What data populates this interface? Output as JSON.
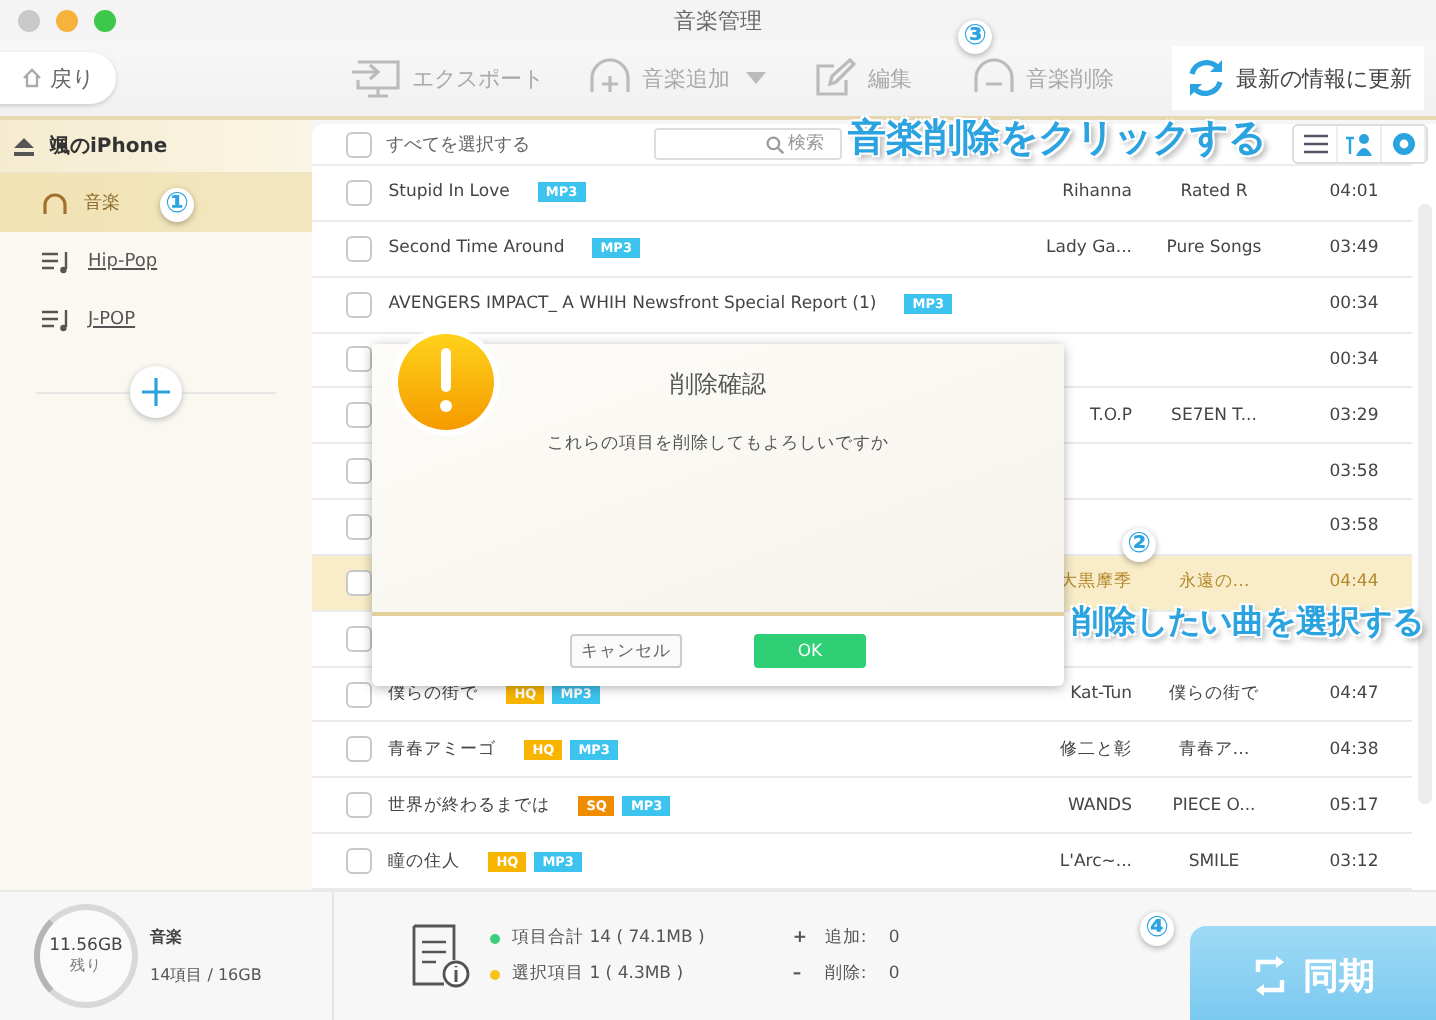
{
  "window": {
    "title": "音楽管理"
  },
  "toolbar": {
    "back": "戻り",
    "items": [
      {
        "kind": "export",
        "label": "エクスポート"
      },
      {
        "kind": "add",
        "label": "音楽追加"
      },
      {
        "kind": "edit",
        "label": "編集"
      },
      {
        "kind": "delete",
        "label": "音楽削除"
      }
    ],
    "refresh": "最新の情報に更新"
  },
  "sidebar": {
    "device": "颯のiPhone",
    "items": [
      {
        "kind": "music",
        "label": "音楽",
        "selected": true
      },
      {
        "kind": "playlist",
        "label": "Hip-Pop",
        "selected": false
      },
      {
        "kind": "playlist",
        "label": "J-POP",
        "selected": false
      }
    ]
  },
  "list_header": {
    "select_all": "すべてを選択する",
    "checked": false,
    "search": {
      "placeholder": "検索"
    }
  },
  "rows": [
    {
      "title": "Stupid In Love",
      "tags": [
        {
          "label": "MP3",
          "color": "#3cc3ee"
        }
      ],
      "artist": "Rihanna",
      "album": "Rated R",
      "time": "04:01",
      "selected": false
    },
    {
      "title": "Second Time Around",
      "tags": [
        {
          "label": "MP3",
          "color": "#3cc3ee"
        }
      ],
      "artist": "Lady Ga...",
      "album": "Pure Songs",
      "time": "03:49",
      "selected": false
    },
    {
      "title": "AVENGERS IMPACT_ A WHIH Newsfront Special Report (1)",
      "tags": [
        {
          "label": "MP3",
          "color": "#3cc3ee"
        }
      ],
      "time": "00:34",
      "selected": false
    },
    {
      "time": "00:34",
      "selected": false
    },
    {
      "artist": "T.O.P",
      "album": "SE7EN T...",
      "time": "03:29",
      "selected": false
    },
    {
      "time": "03:58",
      "selected": false
    },
    {
      "time": "03:58",
      "selected": false
    },
    {
      "artist": "大黒摩季",
      "album": "永遠の…",
      "time": "04:44",
      "selected": true
    },
    {
      "selected": false
    },
    {
      "title": "僕らの街で",
      "tags": [
        {
          "label": "HQ",
          "color": "#f7b500"
        },
        {
          "label": "MP3",
          "color": "#3cc3ee"
        }
      ],
      "artist": "Kat-Tun",
      "album": "僕らの街で",
      "time": "04:47",
      "selected": false
    },
    {
      "title": "青春アミーゴ",
      "tags": [
        {
          "label": "HQ",
          "color": "#f7b500"
        },
        {
          "label": "MP3",
          "color": "#3cc3ee"
        }
      ],
      "artist": "修二と彰",
      "album": "青春ア…",
      "time": "04:38",
      "selected": false
    },
    {
      "title": "世界が終わるまでは",
      "tags": [
        {
          "label": "SQ",
          "color": "#f08c00"
        },
        {
          "label": "MP3",
          "color": "#3cc3ee"
        }
      ],
      "artist": "WANDS",
      "album": "PIECE O...",
      "time": "05:17",
      "selected": false
    },
    {
      "title": "瞳の住人",
      "tags": [
        {
          "label": "HQ",
          "color": "#f7b500"
        },
        {
          "label": "MP3",
          "color": "#3cc3ee"
        }
      ],
      "artist": "L'Arc~...",
      "album": "SMILE",
      "time": "03:12",
      "selected": false
    }
  ],
  "dialog": {
    "title": "削除確認",
    "message": "これらの項目を削除してもよろしいですか",
    "cancel": "キャンセル",
    "ok": "OK"
  },
  "footer": {
    "storage": {
      "free": "11.56GB",
      "free_label": "残り",
      "category": "音楽",
      "usage": "14項目 / 16GB"
    },
    "stats": [
      {
        "label": "項目合計 14 ( 74.1MB )",
        "color": "#3ccf7a"
      },
      {
        "label": "選択項目 1 ( 4.3MB )",
        "color": "#f7c21c"
      }
    ],
    "changes": [
      {
        "sign": "+",
        "label": "追加:",
        "value": "0"
      },
      {
        "sign": "–",
        "label": "削除:",
        "value": "0"
      }
    ],
    "sync": "同期"
  },
  "annotations": [
    {
      "number": "①"
    },
    {
      "number": "②",
      "text": "削除したい曲を選択する"
    },
    {
      "number": "③",
      "text": "音楽削除をクリックする"
    },
    {
      "number": "④"
    }
  ]
}
